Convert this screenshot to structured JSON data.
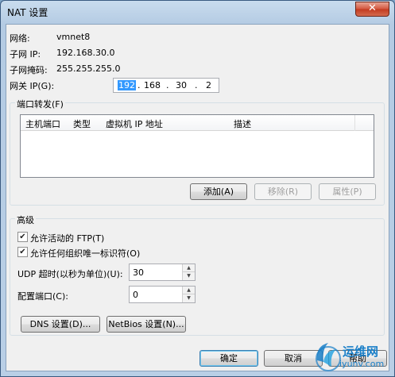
{
  "window": {
    "title": "NAT 设置",
    "close_glyph": "✕"
  },
  "network": {
    "network_label": "网络:",
    "network_value": "vmnet8",
    "subnet_ip_label": "子网 IP:",
    "subnet_ip_value": "192.168.30.0",
    "subnet_mask_label": "子网掩码:",
    "subnet_mask_value": "255.255.255.0",
    "gateway_label": "网关 IP(G):",
    "gateway_octets": [
      "192",
      ".",
      "168",
      ".",
      "30",
      ".",
      "2"
    ]
  },
  "port_forwarding": {
    "group_label": "端口转发(F)",
    "columns": [
      "主机端口",
      "类型",
      "虚拟机 IP 地址",
      "描述"
    ],
    "add_label": "添加(A)",
    "remove_label": "移除(R)",
    "properties_label": "属性(P)"
  },
  "advanced": {
    "group_label": "高级",
    "allow_ftp_label": "允许活动的 FTP(T)",
    "allow_ftp_checked": true,
    "allow_unique_label": "允许任何组织唯一标识符(O)",
    "allow_unique_checked": true,
    "udp_timeout_label": "UDP 超时(以秒为单位)(U):",
    "udp_timeout_value": "30",
    "config_port_label": "配置端口(C):",
    "config_port_value": "0",
    "dns_label": "DNS 设置(D)...",
    "netbios_label": "NetBios 设置(N)..."
  },
  "footer": {
    "ok_label": "确定",
    "cancel_label": "取消",
    "help_label": "帮助"
  },
  "watermark": {
    "line1": "运维网",
    "line2": "iyunv.com"
  },
  "colors": {
    "accent": "#3399ff",
    "titlebar": "#c9dcee",
    "close": "#c23a1f"
  }
}
